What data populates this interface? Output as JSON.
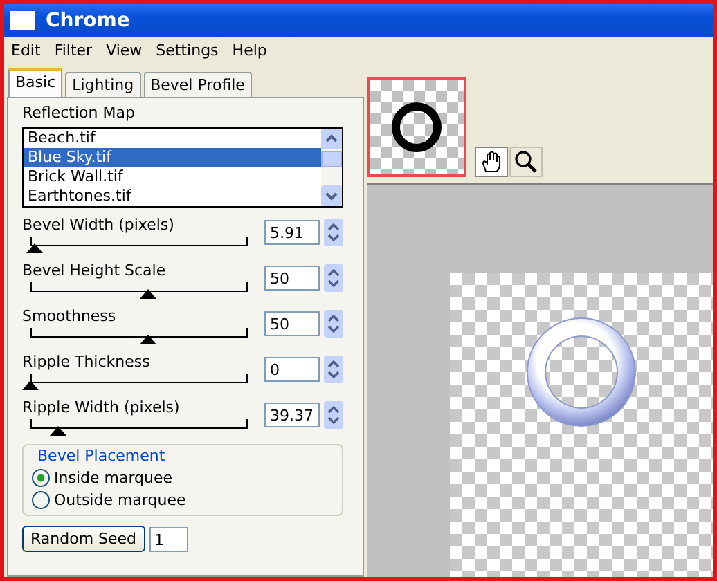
{
  "window": {
    "title": "Chrome"
  },
  "menu": [
    "Edit",
    "Filter",
    "View",
    "Settings",
    "Help"
  ],
  "tabs": [
    {
      "label": "Basic",
      "selected": true
    },
    {
      "label": "Lighting",
      "selected": false
    },
    {
      "label": "Bevel Profile",
      "selected": false
    }
  ],
  "reflection_map": {
    "label": "Reflection Map",
    "items": [
      {
        "label": "Beach.tif",
        "selected": false
      },
      {
        "label": "Blue Sky.tif",
        "selected": true
      },
      {
        "label": "Brick Wall.tif",
        "selected": false
      },
      {
        "label": "Earthtones.tif",
        "selected": false
      }
    ]
  },
  "sliders": [
    {
      "label": "Bevel Width (pixels)",
      "value": "5.91",
      "level": 0.02
    },
    {
      "label": "Bevel Height Scale",
      "value": "50",
      "level": 0.5
    },
    {
      "label": "Smoothness",
      "value": "50",
      "level": 0.5
    },
    {
      "label": "Ripple Thickness",
      "value": "0",
      "level": 0
    },
    {
      "label": "Ripple Width (pixels)",
      "value": "39.37",
      "level": 0.12
    }
  ],
  "bevel_placement": {
    "label": "Bevel Placement",
    "options": [
      {
        "label": "Inside marquee",
        "selected": true
      },
      {
        "label": "Outside marquee",
        "selected": false
      }
    ]
  },
  "random_seed": {
    "button": "Random Seed",
    "value": "1"
  }
}
